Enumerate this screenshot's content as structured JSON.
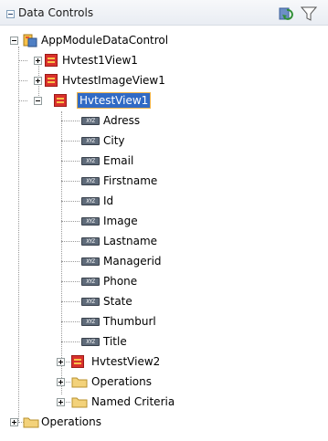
{
  "panel": {
    "title": "Data Controls"
  },
  "tree": {
    "root_label": "AppModuleDataControl",
    "views": [
      {
        "label": "Hvtest1View1"
      },
      {
        "label": "HvtestImageView1"
      },
      {
        "label": "HvtestView1"
      }
    ],
    "attributes": [
      {
        "label": "Adress"
      },
      {
        "label": "City"
      },
      {
        "label": "Email"
      },
      {
        "label": "Firstname"
      },
      {
        "label": "Id"
      },
      {
        "label": "Image"
      },
      {
        "label": "Lastname"
      },
      {
        "label": "Managerid"
      },
      {
        "label": "Phone"
      },
      {
        "label": "State"
      },
      {
        "label": "Thumburl"
      },
      {
        "label": "Title"
      }
    ],
    "attribute_icon_text": "XYZ",
    "child_nodes": [
      {
        "label": "HvtestView2",
        "icon": "view-icon"
      },
      {
        "label": "Operations",
        "icon": "folder-icon"
      },
      {
        "label": "Named Criteria",
        "icon": "folder-icon"
      }
    ],
    "root_operations": {
      "label": "Operations",
      "icon": "folder-icon"
    }
  },
  "colors": {
    "selection": "#316ac5",
    "view_icon": "#d9302c",
    "folder": "#f3d27a"
  }
}
